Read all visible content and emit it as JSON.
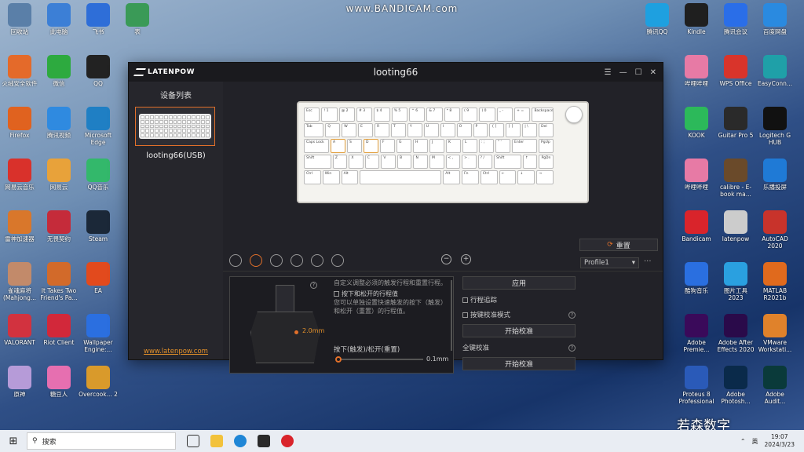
{
  "watermark": "www.BANDICAM.com",
  "desktop": {
    "left_icons": [
      {
        "label": "回收站",
        "color": "#5a7fa8"
      },
      {
        "label": "此电脑",
        "color": "#3c7fd6"
      },
      {
        "label": "飞书",
        "color": "#2e6ed8"
      },
      {
        "label": "表",
        "color": "#3a9a57"
      },
      {
        "label": "火绒安全软件",
        "color": "#e46a2a"
      },
      {
        "label": "微信",
        "color": "#2daa3f"
      },
      {
        "label": "QQ",
        "color": "#222222"
      },
      {
        "label": "Firefox",
        "color": "#e0621f"
      },
      {
        "label": "腾讯视频",
        "color": "#2f8ae0"
      },
      {
        "label": "Microsoft Edge",
        "color": "#1f7fc4"
      },
      {
        "label": "网易云音乐",
        "color": "#d9312b"
      },
      {
        "label": "网易云",
        "color": "#e8a23a"
      },
      {
        "label": "QQ音乐",
        "color": "#33b86b"
      },
      {
        "label": "雷神加速器",
        "color": "#d9772b"
      },
      {
        "label": "无畏契约",
        "color": "#c52b3a"
      },
      {
        "label": "Steam",
        "color": "#1b2838"
      },
      {
        "label": "雀魂麻将(Mahjong...",
        "color": "#c28a6a"
      },
      {
        "label": "It Takes Two Friend's Pa...",
        "color": "#d26a2a"
      },
      {
        "label": "EA",
        "color": "#e24a1d"
      },
      {
        "label": "VALORANT",
        "color": "#d2323f"
      },
      {
        "label": "Riot Client",
        "color": "#d2283a"
      },
      {
        "label": "Wallpaper Engine:...",
        "color": "#2b6fe0"
      },
      {
        "label": "原神",
        "color": "#b69bd8"
      },
      {
        "label": "糖豆人",
        "color": "#e66fb0"
      },
      {
        "label": "Overcook... 2",
        "color": "#d99a2b"
      }
    ],
    "right_icons": [
      {
        "label": "腾讯QQ",
        "color": "#1ea0e0"
      },
      {
        "label": "Kindle",
        "color": "#1f1f1f"
      },
      {
        "label": "腾讯会议",
        "color": "#2a6ee8"
      },
      {
        "label": "百度网盘",
        "color": "#2a8ae0"
      },
      {
        "label": "哔哩哔哩",
        "color": "#e77aa5"
      },
      {
        "label": "WPS Office",
        "color": "#d9342b"
      },
      {
        "label": "EasyConn...",
        "color": "#1fa0a8"
      },
      {
        "label": "KOOK",
        "color": "#2cb95a"
      },
      {
        "label": "Guitar Pro 5",
        "color": "#2a2a2a"
      },
      {
        "label": "Logitech G HUB",
        "color": "#111111"
      },
      {
        "label": "哔哩哔哩",
        "color": "#e77aa5"
      },
      {
        "label": "calibre - E-book ma...",
        "color": "#6a4a2a"
      },
      {
        "label": "乐播投屏",
        "color": "#1f7ad6"
      },
      {
        "label": "Bandicam",
        "color": "#d9242b"
      },
      {
        "label": "latenpow",
        "color": "#cccccc"
      },
      {
        "label": "AutoCAD 2020",
        "color": "#c8332b"
      },
      {
        "label": "酷狗音乐",
        "color": "#2a6fe0"
      },
      {
        "label": "图片工具 2023",
        "color": "#2aa0e0"
      },
      {
        "label": "MATLAB R2021b",
        "color": "#e06a1d"
      },
      {
        "label": "Adobe Premie...",
        "color": "#3a0a5a"
      },
      {
        "label": "Adobe After Effects 2020",
        "color": "#2a0a4a"
      },
      {
        "label": "VMware Workstati...",
        "color": "#e0822b"
      },
      {
        "label": "Proteus 8 Professional",
        "color": "#2a5ab8"
      },
      {
        "label": "Adobe Photosh...",
        "color": "#0a2a4a"
      },
      {
        "label": "Adobe Audit...",
        "color": "#0a3a3a"
      }
    ]
  },
  "corner_text": "若森数字",
  "app": {
    "brand": "LATENPOW",
    "title": "looting66",
    "controls": [
      "☰",
      "—",
      "☐",
      "✕"
    ],
    "sidebar": {
      "header": "设备列表",
      "device_name": "looting66(USB)",
      "website": "www.latenpow.com"
    },
    "keyboard": {
      "rows": [
        [
          "Esc",
          "! 1",
          "@ 2",
          "# 3",
          "$ 4",
          "% 5",
          "^ 6",
          "& 7",
          "* 8",
          "( 9",
          ") 0",
          "_ -",
          "+ =",
          "Backspace"
        ],
        [
          "Tab",
          "Q",
          "W",
          "E",
          "R",
          "T",
          "Y",
          "U",
          "I",
          "O",
          "P",
          "{ [",
          "} ]",
          "| \\",
          "Del"
        ],
        [
          "Caps Lock",
          "A",
          "S",
          "D",
          "F",
          "G",
          "H",
          "J",
          "K",
          "L",
          ": ;",
          "\" '",
          "Enter",
          "PgUp"
        ],
        [
          "Shift",
          "Z",
          "X",
          "C",
          "V",
          "B",
          "N",
          "M",
          "< ,",
          "> .",
          "? /",
          "Shift",
          "↑",
          "PgDn"
        ],
        [
          "Ctrl",
          "Win",
          "Alt",
          "",
          "Alt",
          "Fn",
          "Ctrl",
          "←",
          "↓",
          "→"
        ]
      ]
    },
    "reset_label": "重置",
    "profile_selected": "Profile1",
    "zoom_out": "−",
    "zoom_in": "+",
    "more": "···",
    "switch_panel": {
      "travel_display": "2.0mm",
      "text_top": "自定义调整必须的触发行程和重置行程。",
      "option_label": "按下和松开的行程值",
      "option_desc": "您可以单独设置快速触发的按下（触发）和松开（重置）的行程值。",
      "slider_label": "按下(触发)/松开(重置)",
      "slider_value": "0.1mm",
      "slider_fraction": 0.0
    },
    "right_panel": {
      "apply_label": "应用",
      "trace_label": "行程追踪",
      "calib_mode_label": "按键校准模式",
      "start_calib_label": "开始校准",
      "full_calib_label": "全键校准",
      "start_calib_label2": "开始校准"
    }
  },
  "taskbar": {
    "search_placeholder": "搜索",
    "ime": "英",
    "time": "19:07",
    "date": "2024/3/23"
  }
}
